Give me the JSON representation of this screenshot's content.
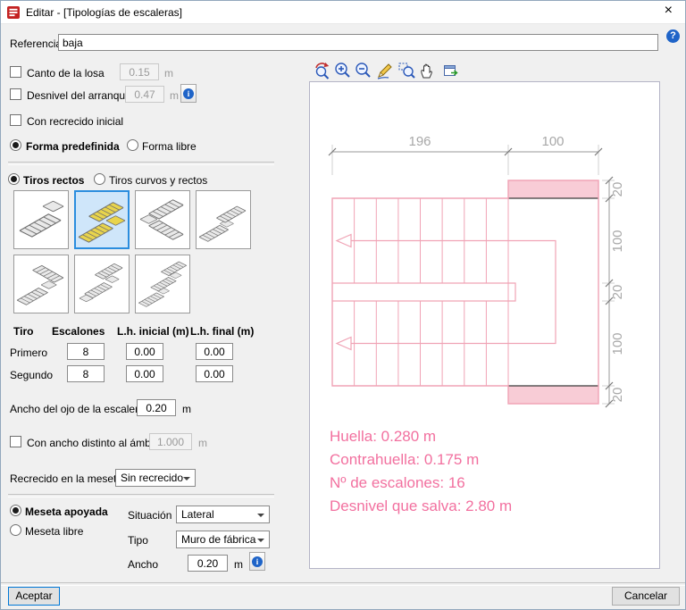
{
  "window": {
    "title": "Editar - [Tipologías de escaleras]",
    "close_glyph": "×",
    "help_glyph": "?"
  },
  "header": {
    "referencia_label": "Referencia",
    "referencia_value": "baja"
  },
  "options": {
    "canto_label": "Canto de la losa",
    "canto_value": "0.15",
    "canto_unit": "m",
    "desnivel_label": "Desnivel del arranque",
    "desnivel_value": "0.47",
    "desnivel_unit": "m",
    "recrecido_inicial_label": "Con recrecido inicial",
    "forma_predefinida_label": "Forma predefinida",
    "forma_libre_label": "Forma libre",
    "tiros_rectos_label": "Tiros rectos",
    "tiros_curvos_label": "Tiros curvos y rectos"
  },
  "tipologias": {
    "selected_index": 1,
    "count": 7
  },
  "tiros_table": {
    "col_tiro": "Tiro",
    "col_escalones": "Escalones",
    "col_lh_inicial": "L.h. inicial (m)",
    "col_lh_final": "L.h. final (m)",
    "rows": [
      {
        "nombre": "Primero",
        "escalones": "8",
        "lh_inicial": "0.00",
        "lh_final": "0.00"
      },
      {
        "nombre": "Segundo",
        "escalones": "8",
        "lh_inicial": "0.00",
        "lh_final": "0.00"
      }
    ]
  },
  "ancho_ojo": {
    "label": "Ancho del ojo de la escalera",
    "value": "0.20",
    "unit": "m"
  },
  "ancho_distinto": {
    "label": "Con ancho distinto al ámbito",
    "value": "1.000",
    "unit": "m"
  },
  "recrecido_meseta": {
    "label": "Recrecido en la meseta",
    "value": "Sin recrecido"
  },
  "meseta": {
    "apoyada_label": "Meseta apoyada",
    "libre_label": "Meseta libre",
    "situacion_label": "Situación",
    "situacion_value": "Lateral",
    "tipo_label": "Tipo",
    "tipo_value": "Muro de fábrica",
    "ancho_label": "Ancho",
    "ancho_value": "0.20",
    "ancho_unit": "m"
  },
  "drawing": {
    "dim_top": [
      "196",
      "100"
    ],
    "dim_right": [
      "20",
      "100",
      "20",
      "100",
      "20"
    ],
    "annotations": [
      "Huella: 0.280 m",
      "Contrahuella: 0.175 m",
      "Nº de escalones: 16",
      "Desnivel que salva: 2.80 m"
    ],
    "accent_color": "#f2709f",
    "outline_color": "#f0a3b5",
    "fill_color": "#f8ccd6",
    "dim_color": "#a8a8a8"
  },
  "footer": {
    "aceptar": "Aceptar",
    "cancelar": "Cancelar"
  }
}
